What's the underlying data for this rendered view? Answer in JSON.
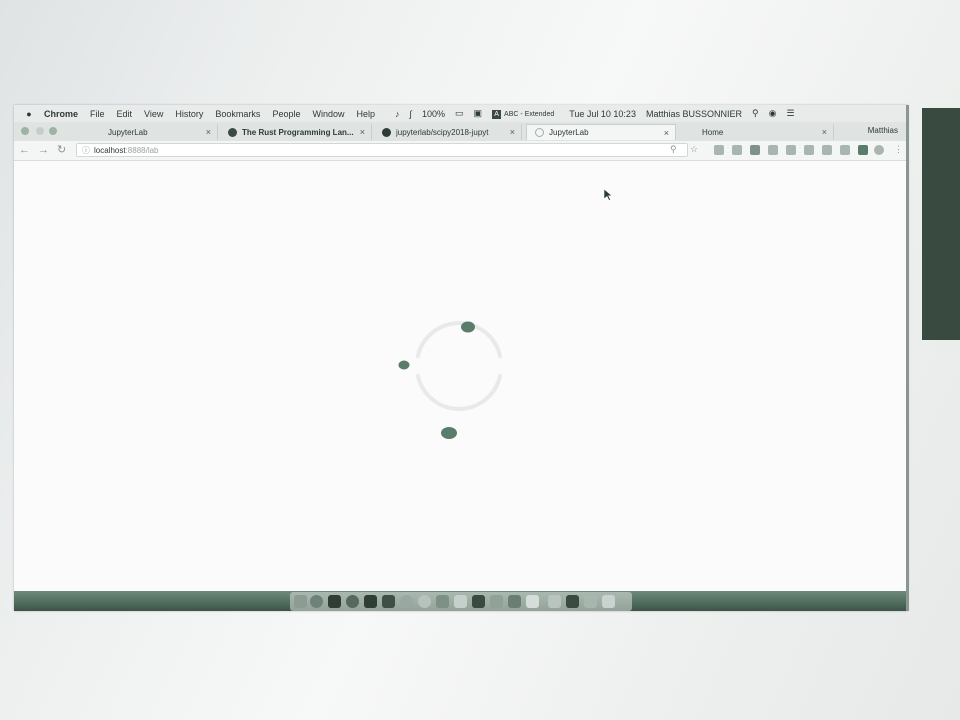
{
  "menubar": {
    "app": "Chrome",
    "items": [
      "File",
      "Edit",
      "View",
      "History",
      "Bookmarks",
      "People",
      "Window",
      "Help"
    ],
    "battery": "100%",
    "input_source_badge": "A",
    "input_source": "ABC - Extended",
    "datetime": "Tue Jul 10  10:23",
    "user": "Matthias BUSSONNIER"
  },
  "tabs": [
    {
      "label": "JupyterLab",
      "icon": "jupyter-icon",
      "active": false
    },
    {
      "label": "The Rust Programming Lan...",
      "icon": "rust-icon",
      "active": false
    },
    {
      "label": "jupyterlab/scipy2018-jupyt",
      "icon": "github-icon",
      "active": false
    },
    {
      "label": "JupyterLab",
      "icon": "jupyter-icon",
      "active": true
    },
    {
      "label": "Home",
      "icon": "",
      "active": false
    }
  ],
  "profile": "Matthias",
  "address": {
    "host": "localhost",
    "rest": ":8888/lab"
  },
  "colors": {
    "accent": "#5a7d6b",
    "side_panel": "#394b41",
    "dock": "#4f6b5c"
  }
}
